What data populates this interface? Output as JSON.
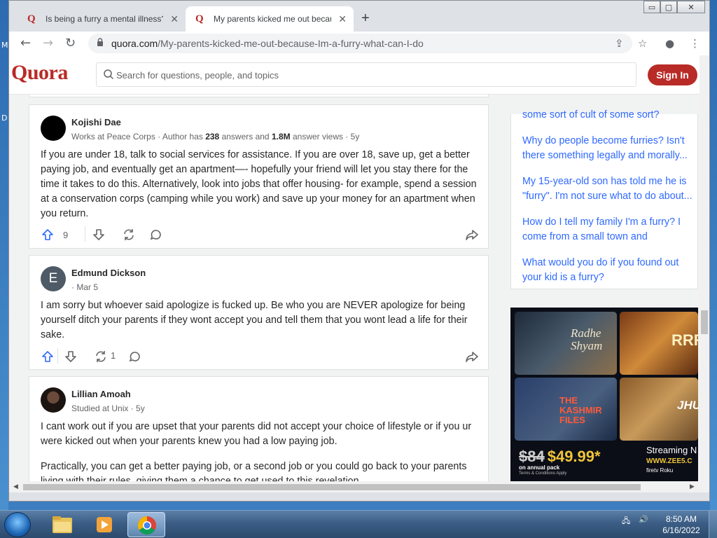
{
  "desktop": {
    "left_glyphs": [
      "M",
      "D"
    ]
  },
  "browser": {
    "tabs": [
      {
        "title": "Is being a furry a mental illness?",
        "close": "✕"
      },
      {
        "title": "My parents kicked me out becau",
        "close": "✕"
      }
    ],
    "new_tab": "+",
    "window_controls": {
      "minimize": "▭",
      "maximize": "▢",
      "close": "✕"
    },
    "url_host": "quora.com",
    "url_path": "/My-parents-kicked-me-out-because-Im-a-furry-what-can-I-do"
  },
  "quora": {
    "brand": "Quora",
    "search_placeholder": "Search for questions, people, and topics",
    "sign_in": "Sign In"
  },
  "answers": [
    {
      "author": "Kojishi Dae",
      "cred_pre": "Works at Peace Corps · Author has ",
      "answers_count": "238",
      "cred_mid": " answers and ",
      "views": "1.8M",
      "cred_post": " answer views · 5y",
      "paragraphs": [
        "If you are under 18, talk to social services for assistance. If you are over 18, save up, get a better paying job, and eventually get an apartment—- hopefully your friend will let you stay there for the time it takes to do this. Alternatively, look into jobs that offer housing- for example, spend a session at a conservation corps (camping while you work) and save up your money for an apartment when you return."
      ],
      "upvotes": "9",
      "shares": ""
    },
    {
      "author": "Edmund Dickson",
      "avatar_letter": "E",
      "cred": "· Mar 5",
      "paragraphs": [
        "I am sorry but whoever said apologize is fucked up. Be who you are NEVER apologize for being yourself ditch your parents if they wont accept you and tell them that you wont lead a life for their sake."
      ],
      "upvotes": "",
      "shares": "1"
    },
    {
      "author": "Lillian Amoah",
      "cred": "Studied at Unix · 5y",
      "paragraphs": [
        "I cant work out if you are upset that your parents did not accept your choice of lifestyle or if you ur were kicked out when your parents knew you had a low paying job.",
        "Practically, you can get a better paying job, or a second job or you could go back to your parents living with their rules, giving them a chance to get used to this revelation."
      ]
    }
  ],
  "related": [
    "some sort of cult of some sort?",
    "Why do people become furries? Isn't there something legally and morally...",
    "My 15-year-old son has told me he is \"furry\". I'm not sure what to do about...",
    "How do I tell my family I'm a furry? I come from a small town and everyone...",
    "What would you do if you found out your kid is a furry?"
  ],
  "ad": {
    "poster_titles": [
      "Radhe Shyam",
      "RRR",
      "THE KASHMIR FILES",
      "JHUND"
    ],
    "old_price": "$84",
    "new_price": "$49.99*",
    "sub": "on annual pack",
    "terms": "Terms & Conditions Apply",
    "stream": "Streaming N",
    "url": "WWW.ZEE5.C",
    "devices": "  firetv  Roku"
  },
  "taskbar": {
    "time": "8:50 AM",
    "date": "6/16/2022"
  },
  "colors": {
    "quora_red": "#b92b27",
    "link_blue": "#2e69ff",
    "text": "#282829",
    "muted": "#636466"
  }
}
